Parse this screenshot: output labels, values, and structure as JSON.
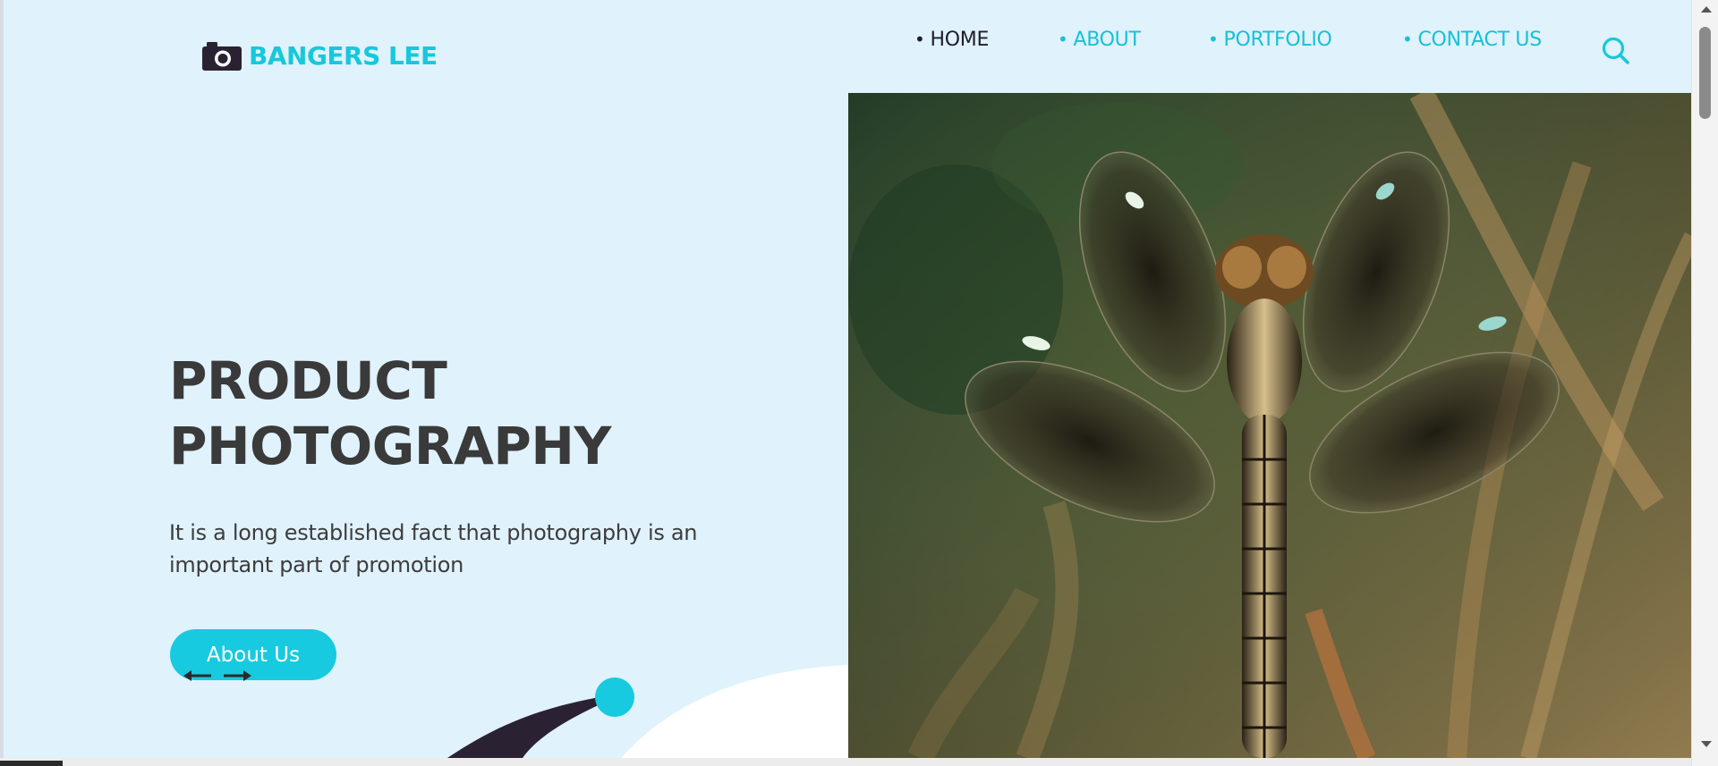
{
  "brand": {
    "name": "BANGERS LEE",
    "icon": "camera-icon",
    "accent": "#17c8dc"
  },
  "nav": {
    "items": [
      {
        "label": "HOME",
        "bullet": "•",
        "active": true
      },
      {
        "label": "ABOUT",
        "bullet": "•",
        "active": false
      },
      {
        "label": "PORTFOLIO",
        "bullet": "•",
        "active": false
      },
      {
        "label": "CONTACT US",
        "bullet": "•",
        "active": false
      }
    ],
    "search_icon": "search-icon"
  },
  "hero": {
    "title_line1": "PRODUCT",
    "title_line2": "PHOTOGRAPHY",
    "description": "It is a long established fact that photography is an important part of promotion",
    "button_label": "About Us",
    "arrows": [
      "arrow-left-icon",
      "arrow-right-icon"
    ],
    "image": "dragonfly-photo"
  },
  "colors": {
    "background": "#e0f2fc",
    "title": "#3a3a3a",
    "button": "#17cadf",
    "dark": "#2a2233"
  }
}
